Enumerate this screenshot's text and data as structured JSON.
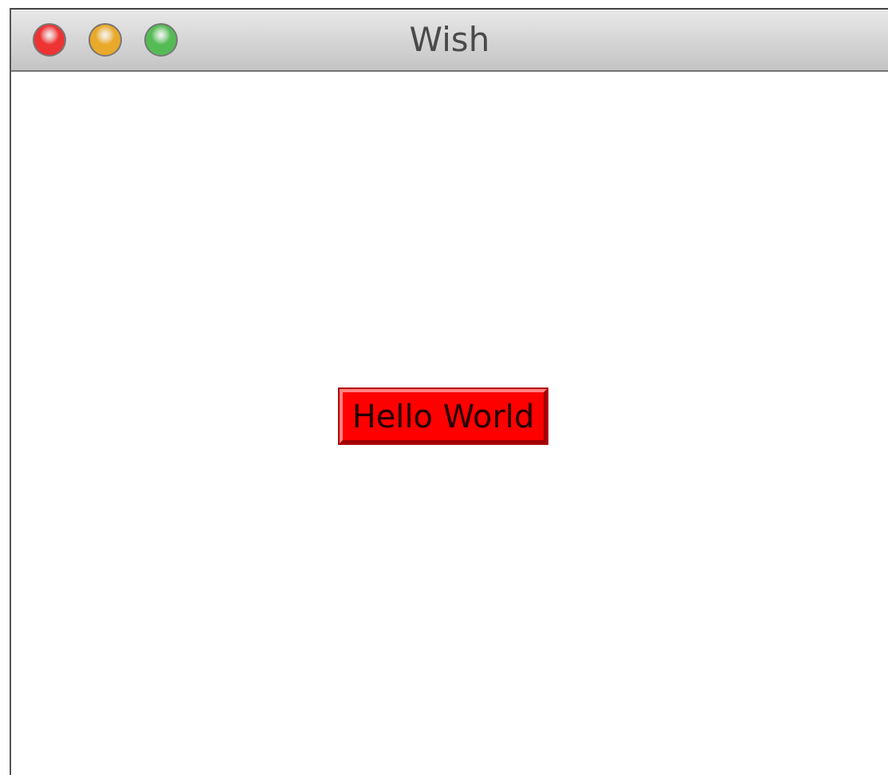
{
  "window": {
    "title": "Wish"
  },
  "button": {
    "label": "Hello World"
  }
}
